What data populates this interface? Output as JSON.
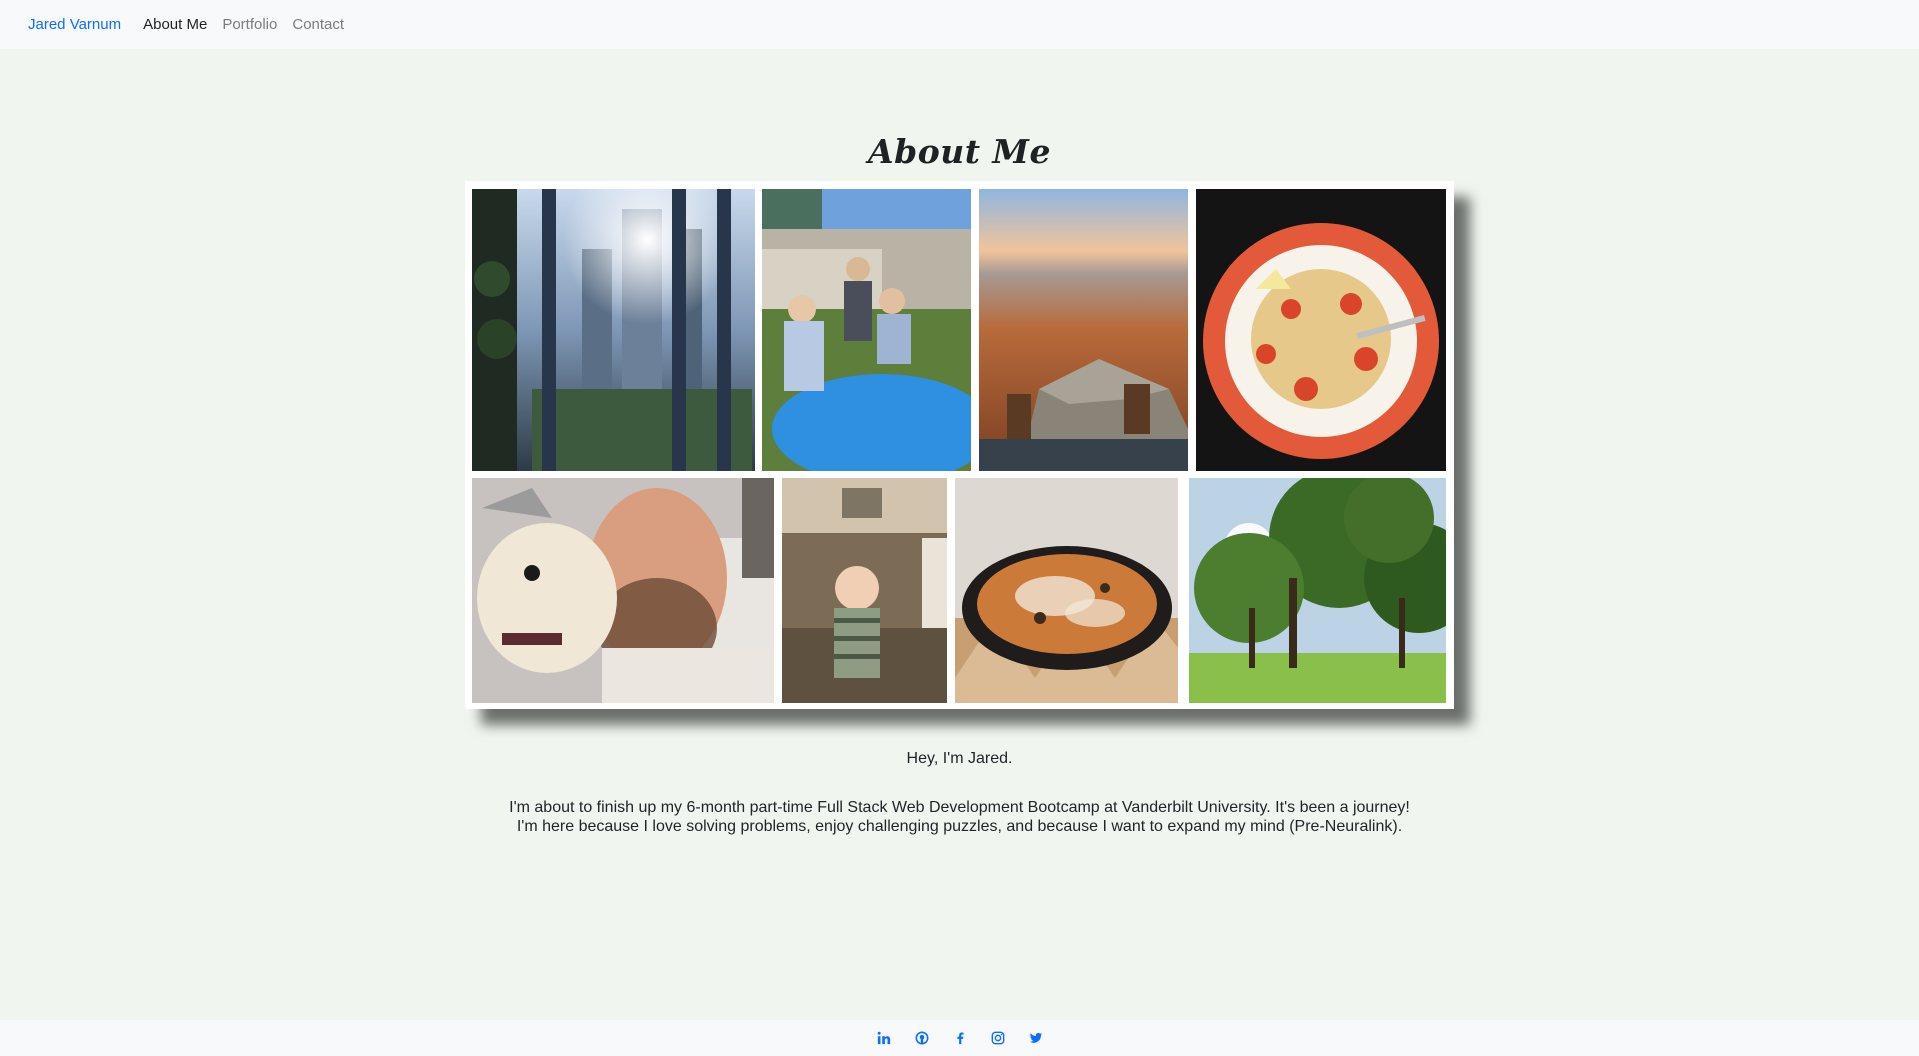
{
  "nav": {
    "brand": "Jared Varnum",
    "links": [
      {
        "label": "About Me",
        "active": true
      },
      {
        "label": "Portfolio",
        "active": false
      },
      {
        "label": "Contact",
        "active": false
      }
    ]
  },
  "main": {
    "title": "About Me",
    "greeting": "Hey, I'm Jared.",
    "paragraph_line1": "I'm about to finish up my 6-month part-time Full Stack Web Development Bootcamp at Vanderbilt University. It's been a journey!",
    "paragraph_line2": "I'm here because I love solving problems, enjoy challenging puzzles, and because I want to expand my mind (Pre-Neuralink)."
  },
  "footer": {
    "icons": [
      "linkedin-icon",
      "github-icon",
      "facebook-icon",
      "instagram-icon",
      "twitter-icon"
    ]
  },
  "colors": {
    "page_bg": "#f0f6ef",
    "nav_bg": "#f8f9fa",
    "accent": "#0d6efd"
  }
}
